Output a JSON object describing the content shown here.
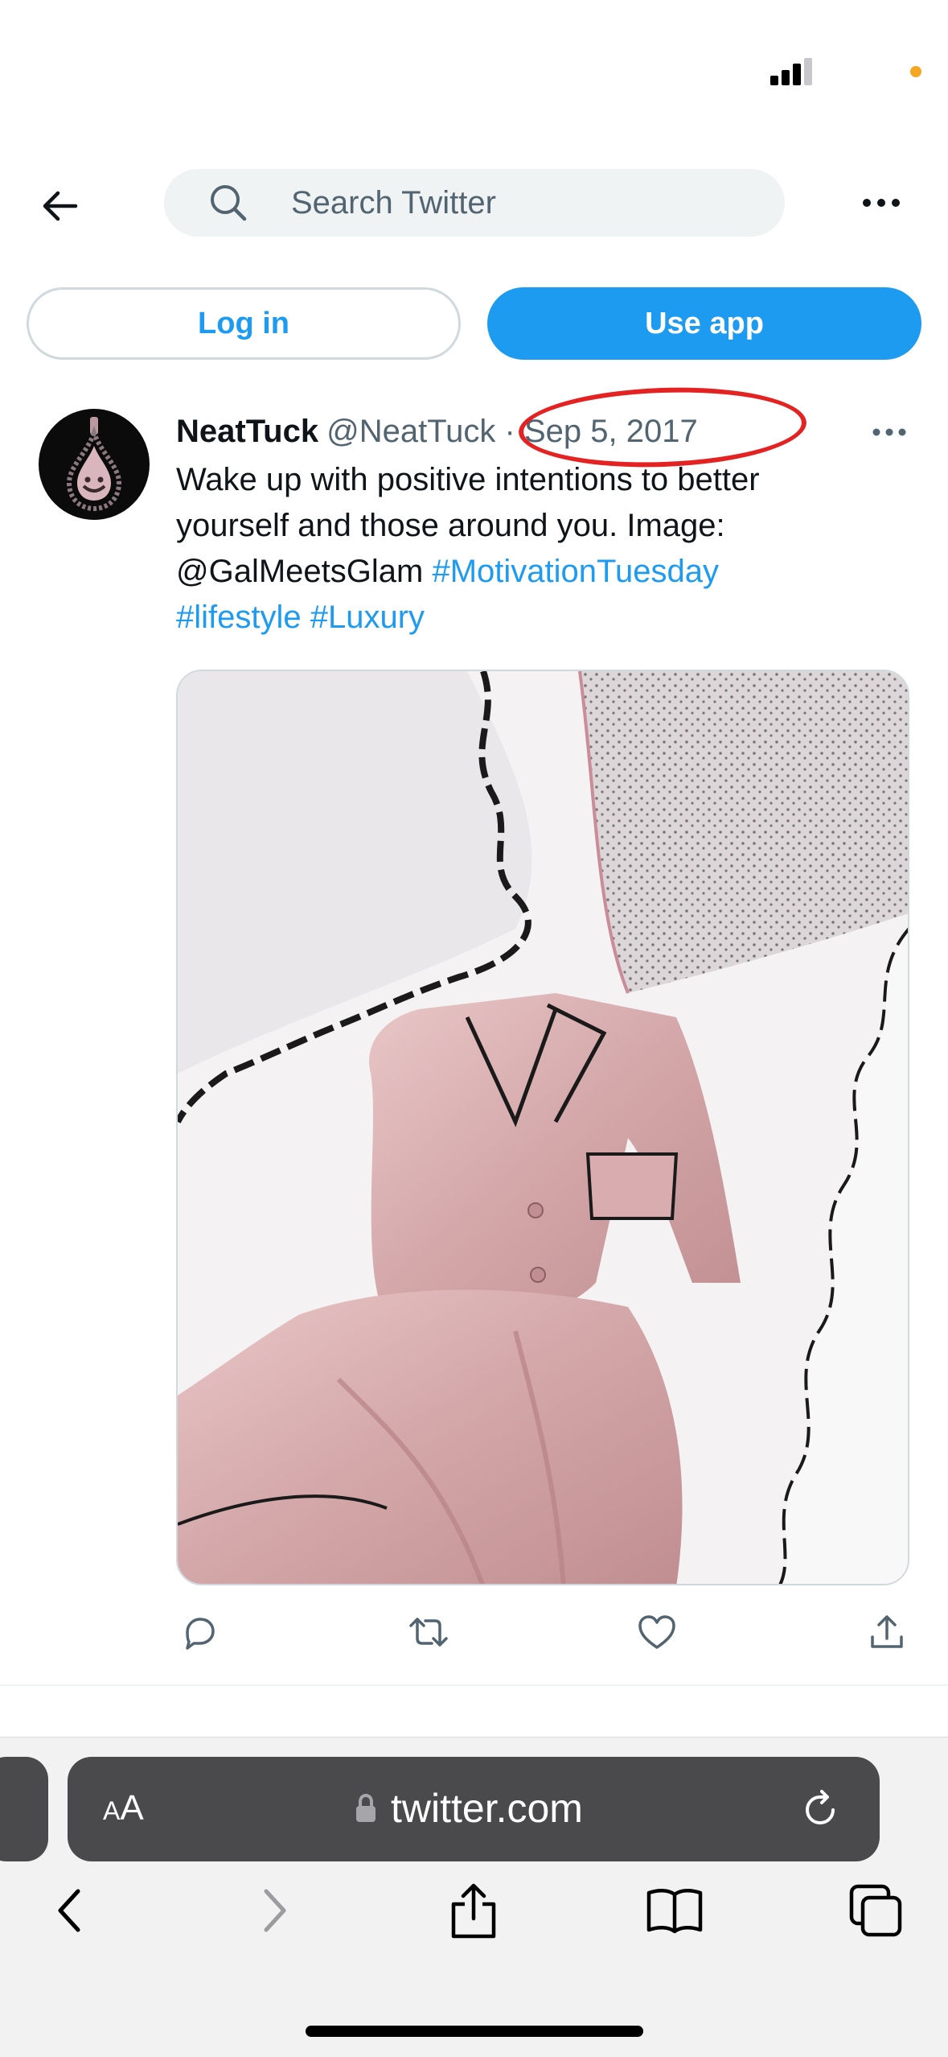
{
  "search": {
    "placeholder": "Search Twitter"
  },
  "auth": {
    "login_label": "Log in",
    "app_label": "Use app"
  },
  "tweet": {
    "display_name": "NeatTuck",
    "handle": "@NeatTuck",
    "separator": "·",
    "date": "Sep 5, 2017",
    "text_lines": {
      "line1": "Wake up with positive intentions to better",
      "line2": "yourself and those around you. Image:",
      "line3_mention": "@GalMeetsGlam",
      "line3_tag": "#MotivationTuesday",
      "line4_tag1": "#lifestyle",
      "line4_tag2": "#Luxury"
    }
  },
  "browser": {
    "aa_small": "A",
    "aa_large": "A",
    "url": "twitter.com"
  },
  "colors": {
    "accent": "#1d9bf0",
    "annotation_circle": "#e52222",
    "status_dot": "#f5a623"
  }
}
